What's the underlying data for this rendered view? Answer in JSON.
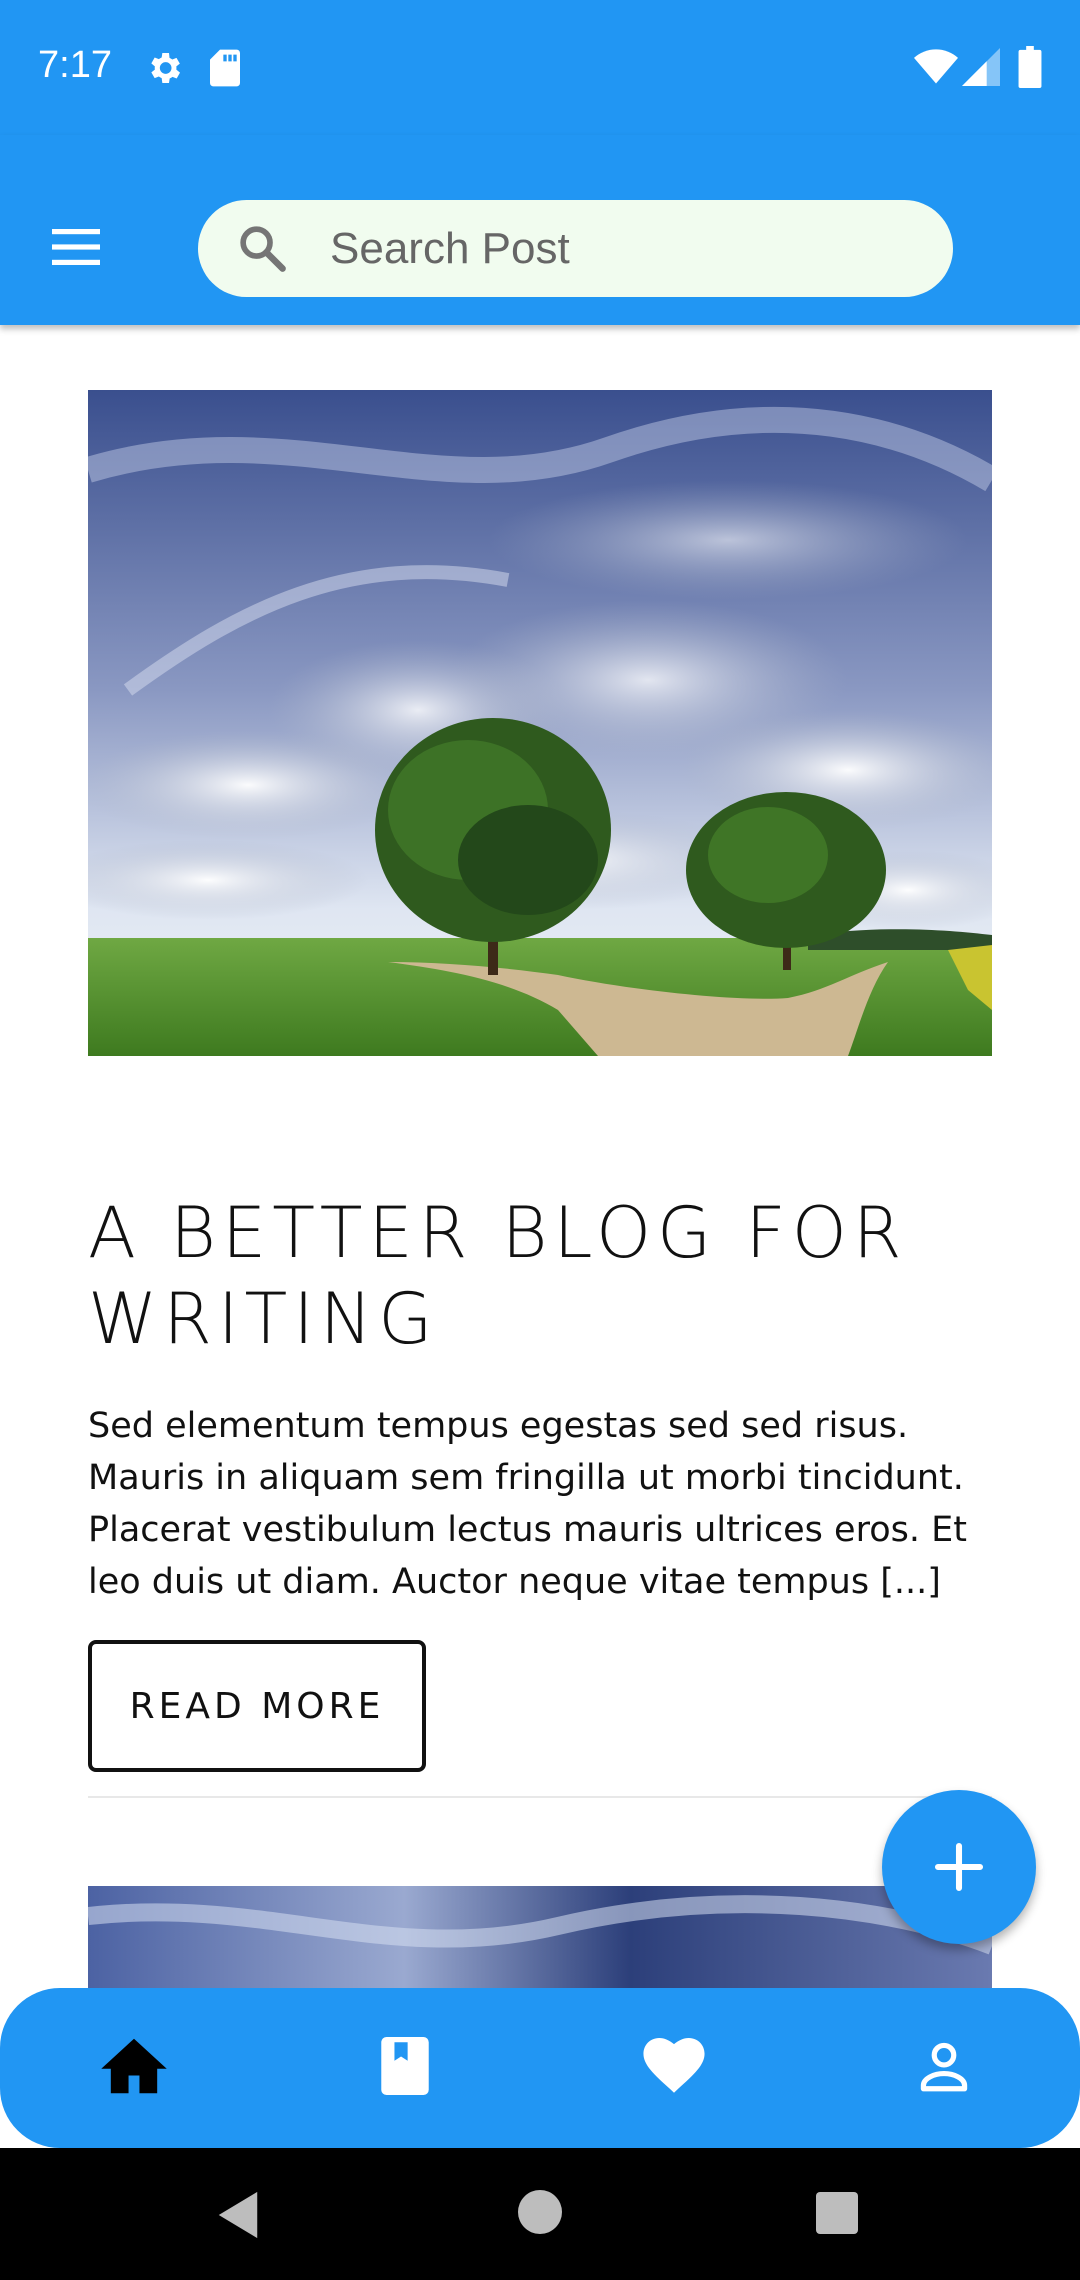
{
  "status_bar": {
    "time": "7:17",
    "icons": [
      "gear-icon",
      "sd-card-icon",
      "wifi-icon",
      "signal-icon",
      "battery-icon"
    ]
  },
  "app_bar": {
    "menu_icon": "menu-icon",
    "search": {
      "placeholder": "Search Post",
      "value": "",
      "icon": "search-icon"
    }
  },
  "posts": [
    {
      "title": "A BETTER BLOG FOR WRITING",
      "excerpt": "Sed elementum tempus egestas sed sed risus. Mauris in aliquam sem fringilla ut morbi tincidunt. Placerat vestibulum lectus mauris ultrices eros. Et leo duis ut diam. Auctor neque vitae tempus [...]",
      "read_more_label": "READ MORE"
    }
  ],
  "fab": {
    "icon": "plus-icon"
  },
  "bottom_nav": {
    "items": [
      {
        "icon": "home-icon",
        "active": true
      },
      {
        "icon": "book-icon",
        "active": false
      },
      {
        "icon": "heart-icon",
        "active": false
      },
      {
        "icon": "person-icon",
        "active": false
      }
    ]
  },
  "system_nav": [
    "back-icon",
    "home-circle-icon",
    "recents-icon"
  ],
  "colors": {
    "primary": "#2196f3",
    "search_background": "#f1fcef",
    "text": "#111111",
    "nav_active": "#000000",
    "nav_inactive": "#ffffff"
  }
}
